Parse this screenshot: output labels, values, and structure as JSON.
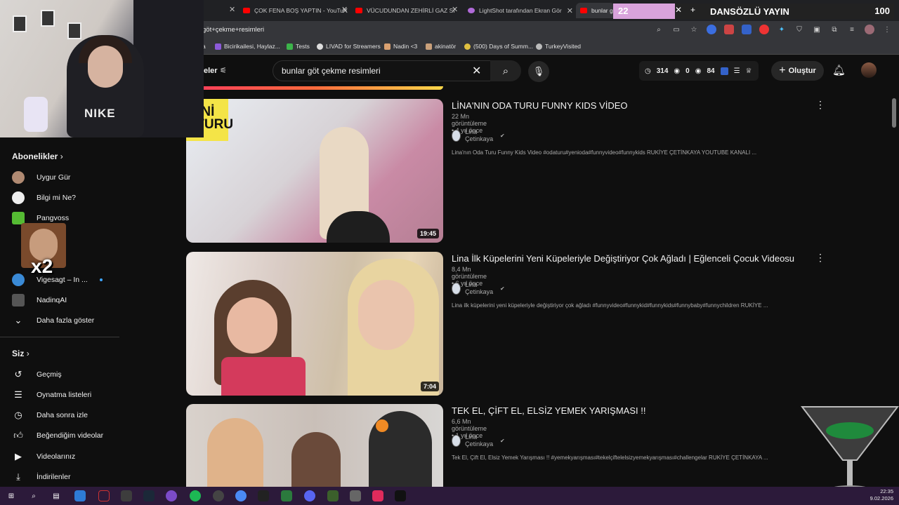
{
  "browser": {
    "tabs": [
      {
        "label": "ÇOK FENA BOŞ YAPTIN - YouTu"
      },
      {
        "label": "VÜCUDUNDAN ZEHİRLİ GAZ Sİ"
      },
      {
        "label": "LightShot tarafından Ekran Gör"
      },
      {
        "label": "bunlar gö"
      }
    ],
    "url": "göt+çekme+resimleri",
    "bookmarks": [
      {
        "label": "a"
      },
      {
        "label": "Bicirikailesi, Haylaz..."
      },
      {
        "label": "Tests"
      },
      {
        "label": "LIVAD for Streamers"
      },
      {
        "label": "Nadin <3"
      },
      {
        "label": "akinatör"
      },
      {
        "label": "(500) Days of Summ..."
      },
      {
        "label": "TurkeyVisited"
      }
    ]
  },
  "youtube": {
    "partial_label": "eler",
    "search_value": "bunlar göt çekme resimleri",
    "stats": {
      "views": "314",
      "a": "0",
      "b": "84"
    },
    "create_label": "Oluştur"
  },
  "sidebar": {
    "subs_title": "Abonelikler",
    "subs": [
      {
        "label": "Uygur Gür"
      },
      {
        "label": "Bilgi mi Ne?"
      },
      {
        "label": "Pangvoss"
      },
      {
        "label": "Vigesagt – In ..."
      },
      {
        "label": "NadinqAI"
      }
    ],
    "show_more": "Daha fazla göster",
    "you_title": "Siz",
    "you_items": [
      {
        "label": "Geçmiş"
      },
      {
        "label": "Oynatma listeleri"
      },
      {
        "label": "Daha sonra izle"
      },
      {
        "label": "Beğendiğim videolar"
      },
      {
        "label": "Videolarınız"
      },
      {
        "label": "İndirilenler"
      }
    ]
  },
  "overlay": {
    "goal_left": "22",
    "goal_title": "DANSÖZLÜ YAYIN",
    "goal_right": "100",
    "goal_fill_fraction": 0.22,
    "emote_text": "x2",
    "webcam_shirt_text": "NIKE"
  },
  "results": [
    {
      "title": "LİNA'NIN ODA TURU FUNNY KIDS VİDEO",
      "meta": "22 Mn görüntüleme • 4 yıl önce",
      "channel": "Lina Çetinkaya",
      "desc": "Lina'nın Oda Turu Funny Kids Video #odaturu#yenioda#funnyvideo#funnykids RUKİYE ÇETİNKAYA YOUTUBE KANALI ...",
      "duration": "19:45",
      "thumb_text": "YENİ\nA TURU"
    },
    {
      "title": "Lina İlk Küpelerini Yeni Küpeleriyle Değiştiriyor Çok Ağladı | Eğlenceli Çocuk Videosu",
      "meta": "8,4 Mn görüntüleme • 6 yıl önce",
      "channel": "Lina Çetinkaya",
      "desc": "Lina ilk küpelerini yeni küpeleriyle değiştiriyor çok ağladı #funnyvideo#funnykid#funnykids#funnybaby#funnychildren RUKİYE ...",
      "duration": "7:04"
    },
    {
      "title": "TEK EL, ÇİFT EL, ELSİZ YEMEK YARIŞMASI !!",
      "meta": "6,6 Mn görüntüleme • 1 yıl önce",
      "channel": "Lina Çetinkaya",
      "desc": "Tek El, Çift El, Elsiz Yemek Yarışması !! #yemekyarışması#tekelçiftelelsizyemekyarışması#challengelar RUKİYE ÇETİNKAYA ..."
    }
  ],
  "taskbar": {
    "time": "22:35",
    "date": "9.02.2026"
  },
  "colors": {
    "bg": "#0f0f0f",
    "accent": "#ff0000",
    "goal": "#d9a3dc"
  }
}
